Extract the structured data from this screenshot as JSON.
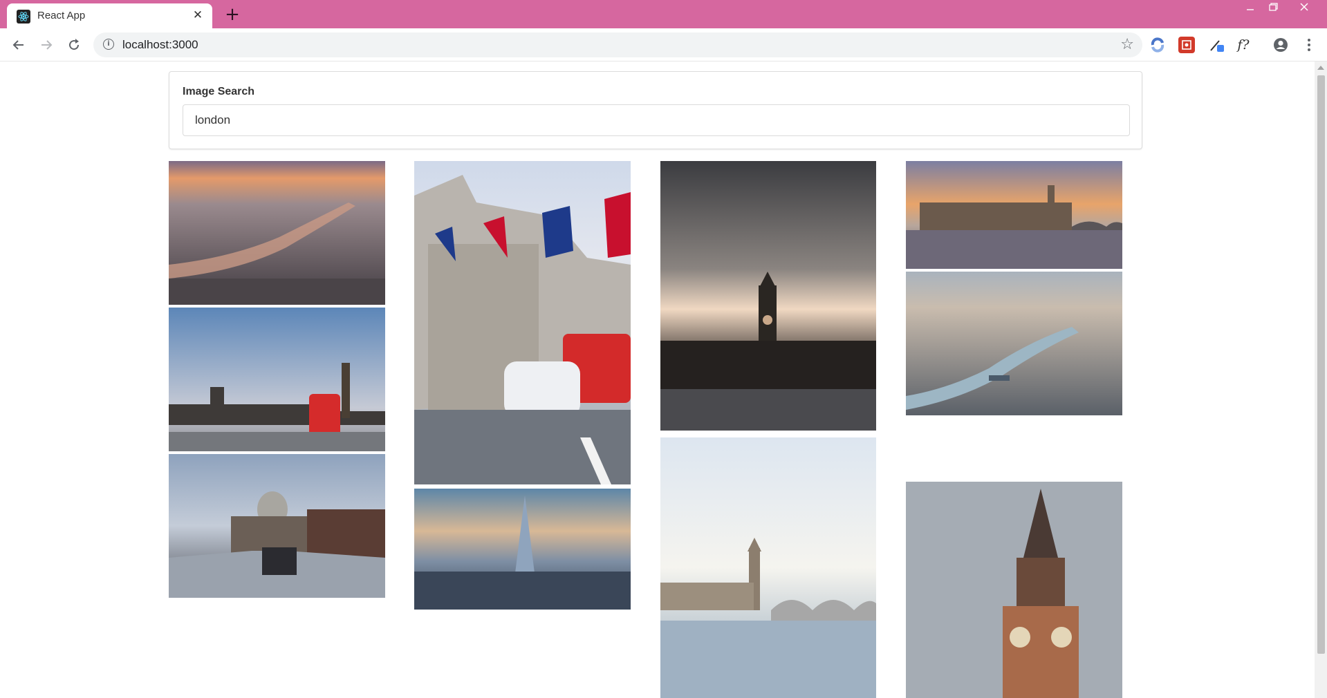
{
  "browser": {
    "tab_title": "React App",
    "url": "localhost:3000",
    "new_tab_symbol": "+",
    "close_symbol": "✕"
  },
  "app": {
    "search_label": "Image Search",
    "search_value": "london"
  },
  "images": [
    {
      "description_key": "aerial-thames-sunset"
    },
    {
      "description_key": "parliament-red-bus"
    },
    {
      "description_key": "st-pauls-millennium-bridge"
    },
    {
      "description_key": "union-jack-street-taxi"
    },
    {
      "description_key": "shard-skyline"
    },
    {
      "description_key": "big-ben-cloudy-dusk"
    },
    {
      "description_key": "westminster-bridge-sunlit"
    },
    {
      "description_key": "parliament-river-sunset"
    },
    {
      "description_key": "aerial-thames-tower-bridge"
    },
    {
      "description_key": "big-ben-closeup"
    }
  ],
  "colors": {
    "titlebar": "#d6679f",
    "accent_extension": "#4285f4"
  }
}
